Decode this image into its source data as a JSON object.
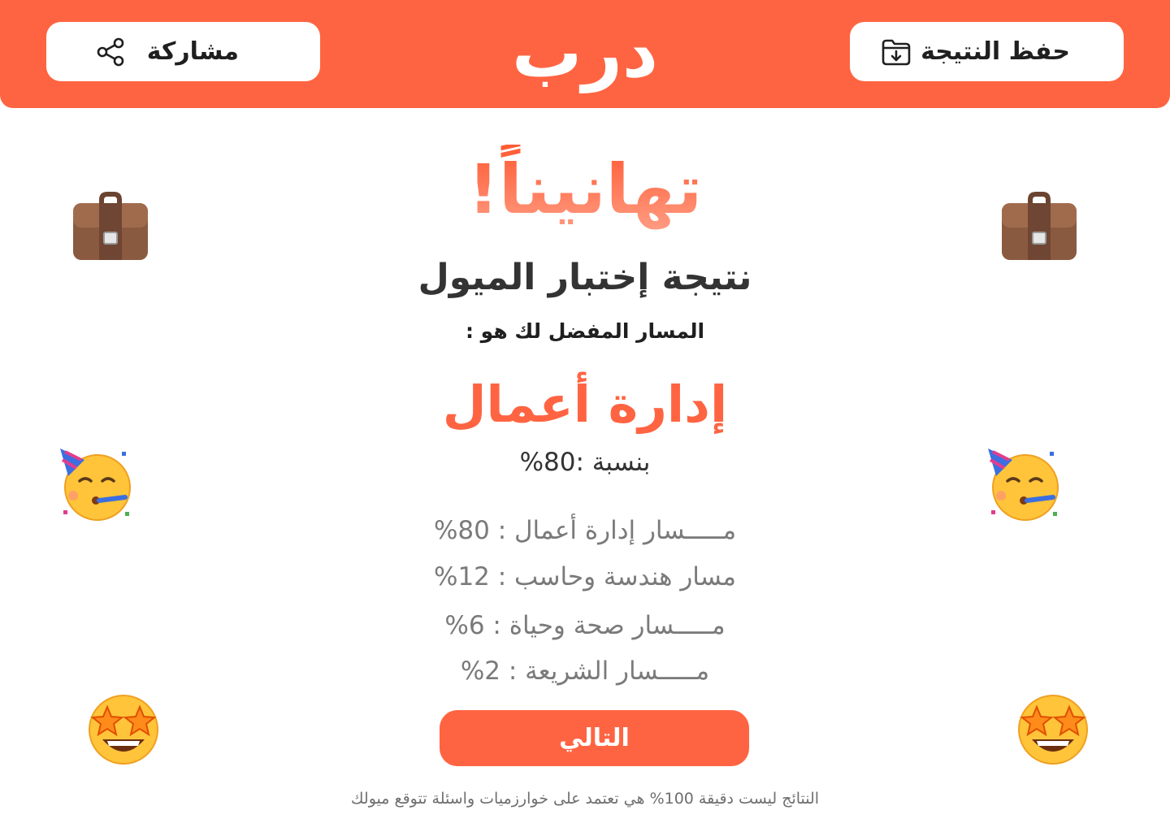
{
  "header": {
    "logo": "درب",
    "save_label": "حفظ النتيجة",
    "share_label": "مشاركة",
    "save_icon": "folder-download-icon",
    "share_icon": "share-icon"
  },
  "main": {
    "congrats": "تهانيناً!",
    "title": "نتيجة إختبار الميول",
    "subtitle": "المسار المفضل لك هو :",
    "track": "إدارة أعمال",
    "ratio": "بنسبة :80%",
    "tracks": [
      {
        "label": "مـــــسار إدارة أعمال : 80%"
      },
      {
        "label": "مسار هندسة وحاسب : 12%"
      },
      {
        "label": "مـــــسار صحة وحياة : 6%"
      },
      {
        "label": "مـــــسار الشريعة : 2%"
      }
    ],
    "next_label": "التالي",
    "disclaimer": "النتائج ليست دقيقة 100% هي تعتمد على خوارزميات واسئلة تتوقع ميولك"
  },
  "decorations": {
    "icons": [
      "briefcase-icon",
      "partying-face-icon",
      "star-struck-icon"
    ]
  },
  "colors": {
    "brand": "#FF6442",
    "text_dark": "#333333",
    "text_muted": "#7a7a7a"
  }
}
